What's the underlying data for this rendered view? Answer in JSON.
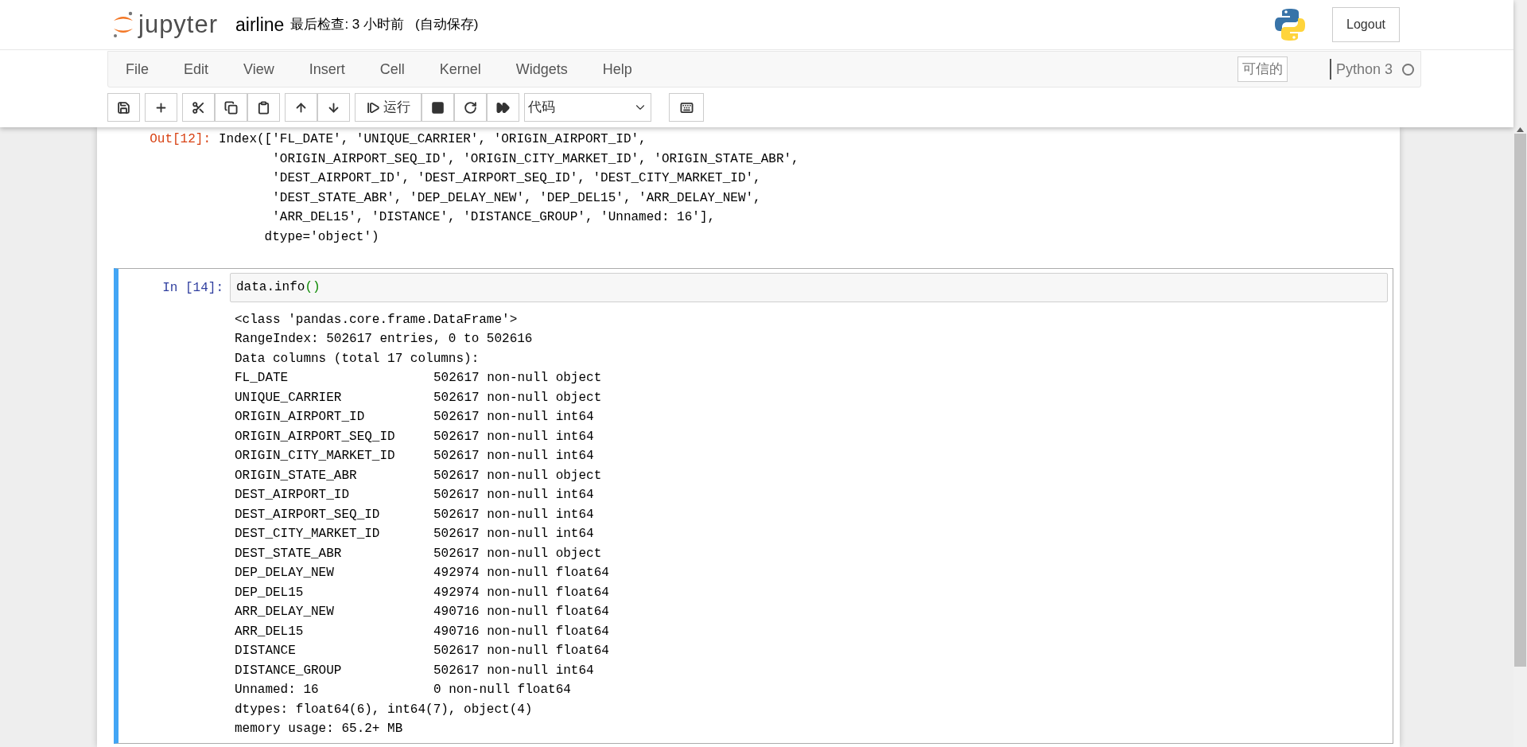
{
  "header": {
    "logo_text": "jupyter",
    "notebook_name": "airline",
    "checkpoint": "最后检查: 3 小时前",
    "autosave": "(自动保存)",
    "logout": "Logout"
  },
  "menu": [
    "File",
    "Edit",
    "View",
    "Insert",
    "Cell",
    "Kernel",
    "Widgets",
    "Help"
  ],
  "trusted": "可信的",
  "kernel": {
    "name": "Python 3",
    "busy": false
  },
  "toolbar": {
    "run_label": "运行",
    "cell_type": "代码"
  },
  "cells": [
    {
      "kind": "output",
      "selected": false,
      "prompt": "Out[12]:",
      "lines": [
        "Index(['FL_DATE', 'UNIQUE_CARRIER', 'ORIGIN_AIRPORT_ID',",
        "       'ORIGIN_AIRPORT_SEQ_ID', 'ORIGIN_CITY_MARKET_ID', 'ORIGIN_STATE_ABR',",
        "       'DEST_AIRPORT_ID', 'DEST_AIRPORT_SEQ_ID', 'DEST_CITY_MARKET_ID',",
        "       'DEST_STATE_ABR', 'DEP_DELAY_NEW', 'DEP_DEL15', 'ARR_DELAY_NEW',",
        "       'ARR_DEL15', 'DISTANCE', 'DISTANCE_GROUP', 'Unnamed: 16'],",
        "      dtype='object')"
      ]
    },
    {
      "kind": "code",
      "selected": true,
      "prompt": "In  [14]:",
      "source": [
        {
          "kind": "name",
          "text": "data.info"
        },
        {
          "kind": "paren",
          "text": "()"
        }
      ],
      "output_head": [
        "<class 'pandas.core.frame.DataFrame'>",
        "RangeIndex: 502617 entries, 0 to 502616",
        "Data columns (total 17 columns):"
      ],
      "rows": [
        {
          "column": "FL_DATE",
          "info": "502617 non-null object"
        },
        {
          "column": "UNIQUE_CARRIER",
          "info": "502617 non-null object"
        },
        {
          "column": "ORIGIN_AIRPORT_ID",
          "info": "502617 non-null int64"
        },
        {
          "column": "ORIGIN_AIRPORT_SEQ_ID",
          "info": "502617 non-null int64"
        },
        {
          "column": "ORIGIN_CITY_MARKET_ID",
          "info": "502617 non-null int64"
        },
        {
          "column": "ORIGIN_STATE_ABR",
          "info": "502617 non-null object"
        },
        {
          "column": "DEST_AIRPORT_ID",
          "info": "502617 non-null int64"
        },
        {
          "column": "DEST_AIRPORT_SEQ_ID",
          "info": "502617 non-null int64"
        },
        {
          "column": "DEST_CITY_MARKET_ID",
          "info": "502617 non-null int64"
        },
        {
          "column": "DEST_STATE_ABR",
          "info": "502617 non-null object"
        },
        {
          "column": "DEP_DELAY_NEW",
          "info": "492974 non-null float64"
        },
        {
          "column": "DEP_DEL15",
          "info": "492974 non-null float64"
        },
        {
          "column": "ARR_DELAY_NEW",
          "info": "490716 non-null float64"
        },
        {
          "column": "ARR_DEL15",
          "info": "490716 non-null float64"
        },
        {
          "column": "DISTANCE",
          "info": "502617 non-null float64"
        },
        {
          "column": "DISTANCE_GROUP",
          "info": "502617 non-null int64"
        },
        {
          "column": "Unnamed: 16",
          "info": "0 non-null float64"
        }
      ],
      "output_tail": [
        "dtypes: float64(6), int64(7), object(4)",
        "memory usage: 65.2+ MB"
      ]
    }
  ]
}
